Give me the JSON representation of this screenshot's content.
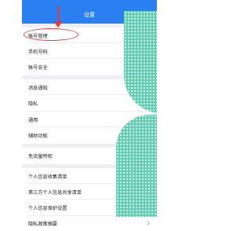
{
  "header": {
    "title": "设置"
  },
  "items": [
    {
      "label": "帐号管理"
    },
    {
      "label": "手机号码"
    },
    {
      "label": "帐号安全"
    },
    {
      "label": "消息通知"
    },
    {
      "label": "隐私"
    },
    {
      "label": "通用"
    },
    {
      "label": "辅助功能"
    },
    {
      "label": "免流量特权"
    },
    {
      "label": "个人信息收集清单"
    },
    {
      "label": "第三方个人信息共享清单"
    },
    {
      "label": "个人信息保护设置"
    },
    {
      "label": "隐私政策摘要"
    }
  ],
  "colors": {
    "header": "#2b7ff0",
    "annotation": "#e53a35",
    "pattern": "#5fd1b0"
  }
}
